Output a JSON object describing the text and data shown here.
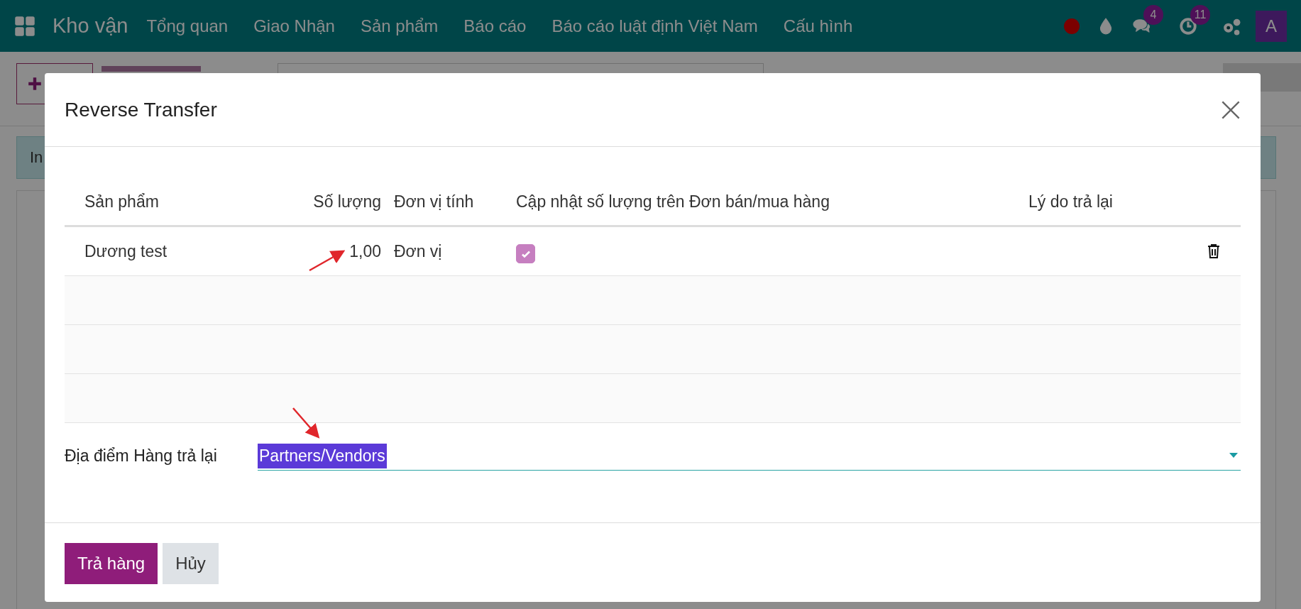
{
  "navbar": {
    "app_name": "Kho vận",
    "menu": [
      "Tổng quan",
      "Giao Nhận",
      "Sản phẩm",
      "Báo cáo",
      "Báo cáo luật định Việt Nam",
      "Cấu hình"
    ],
    "message_count": "4",
    "activity_count": "11",
    "avatar": "A"
  },
  "background": {
    "banner": "In"
  },
  "dialog": {
    "title": "Reverse Transfer",
    "columns": [
      "Sản phẩm",
      "Số lượng",
      "Đơn vị tính",
      "Cập nhật số lượng trên Đơn bán/mua hàng",
      "Lý do trả lại"
    ],
    "rows": [
      {
        "product": "Dương test",
        "quantity": "1,00",
        "uom": "Đơn vị",
        "update_quantity": true
      }
    ],
    "location": {
      "label": "Địa điểm Hàng trả lại",
      "value": "Partners/Vendors",
      "selected": true
    },
    "buttons": [
      {
        "label": "Trả hàng",
        "kind": "primary"
      },
      {
        "label": "Hủy",
        "kind": "secondary"
      }
    ]
  }
}
